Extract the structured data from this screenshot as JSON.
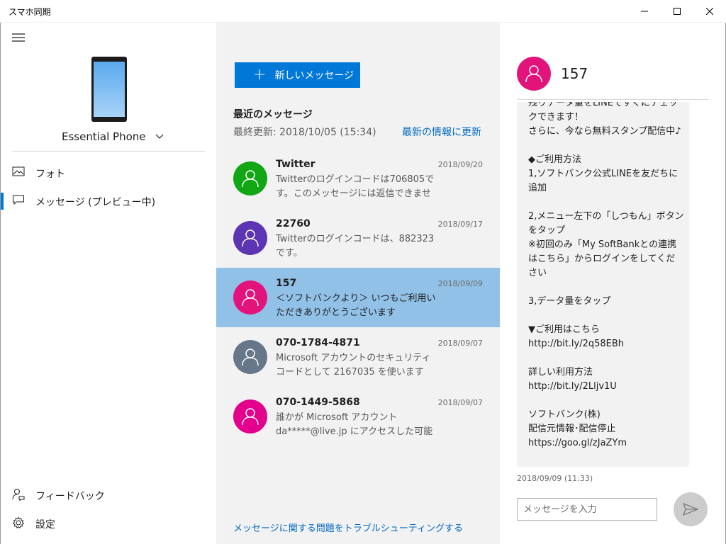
{
  "window": {
    "title": "スマホ同期"
  },
  "device": {
    "name": "Essential Phone"
  },
  "nav": {
    "items": [
      {
        "label": "フォト",
        "icon": "photo-icon",
        "selected": false
      },
      {
        "label": "メッセージ (プレビュー中)",
        "icon": "message-icon",
        "selected": true
      }
    ],
    "bottom": [
      {
        "label": "フィードバック",
        "icon": "feedback-icon"
      },
      {
        "label": "設定",
        "icon": "gear-icon"
      }
    ]
  },
  "messages_panel": {
    "new_message_label": "新しいメッセージ",
    "recent_title": "最近のメッセージ",
    "last_updated": "最終更新: 2018/10/05 (15:34)",
    "refresh_label": "最新の情報に更新",
    "troubleshoot_label": "メッセージに関する問題をトラブルシューティングする",
    "conversations": [
      {
        "name": "Twitter",
        "date": "2018/09/20",
        "preview": "Twitterのログインコードは706805です。このメッセージには返信できません。",
        "avatar_color": "#10a614",
        "selected": false
      },
      {
        "name": "22760",
        "date": "2018/09/17",
        "preview": "Twitterのログインコードは、882323です。",
        "avatar_color": "#5d35b3",
        "selected": false
      },
      {
        "name": "157",
        "date": "2018/09/09",
        "preview": "＜ソフトバンクより＞ いつもご利用いただきありがとうございます",
        "avatar_color": "#e3137c",
        "selected": true
      },
      {
        "name": "070-1784-4871",
        "date": "2018/09/07",
        "preview": "Microsoft アカウントのセキュリティ コードとして 2167035 を使います",
        "avatar_color": "#68768a",
        "selected": false
      },
      {
        "name": "070-1449-5868",
        "date": "2018/09/07",
        "preview": "誰かが Microsoft アカウント da*****@live.jp にアクセスした可能性",
        "avatar_color": "#e3008c",
        "selected": false
      }
    ]
  },
  "conversation": {
    "name": "157",
    "avatar_color": "#e3137c",
    "message_text": "残りデータ量をLINEですぐにチェックできます！\nさらに、今なら無料スタンプ配信中♪\n\n◆ご利用方法\n1,ソフトバンク公式LINEを友だちに追加\n\n2,メニュー左下の「しつもん」ボタンをタップ\n※初回のみ「My SoftBankとの連携はこちら」からログインをしてください\n\n3,データ量をタップ\n\n▼ご利用はこちら\nhttp://bit.ly/2q58EBh\n\n詳しい利用方法\nhttp://bit.ly/2Lljv1U\n\nソフトバンク(株)\n配信元情報･配信停止\nhttps://goo.gl/zJaZYm",
    "timestamp": "2018/09/09 (11:33)",
    "compose_placeholder": "メッセージを入力"
  },
  "colors": {
    "accent": "#0078d7",
    "selected_row": "#92c1e8",
    "mid_bg": "#f2f2f2"
  }
}
